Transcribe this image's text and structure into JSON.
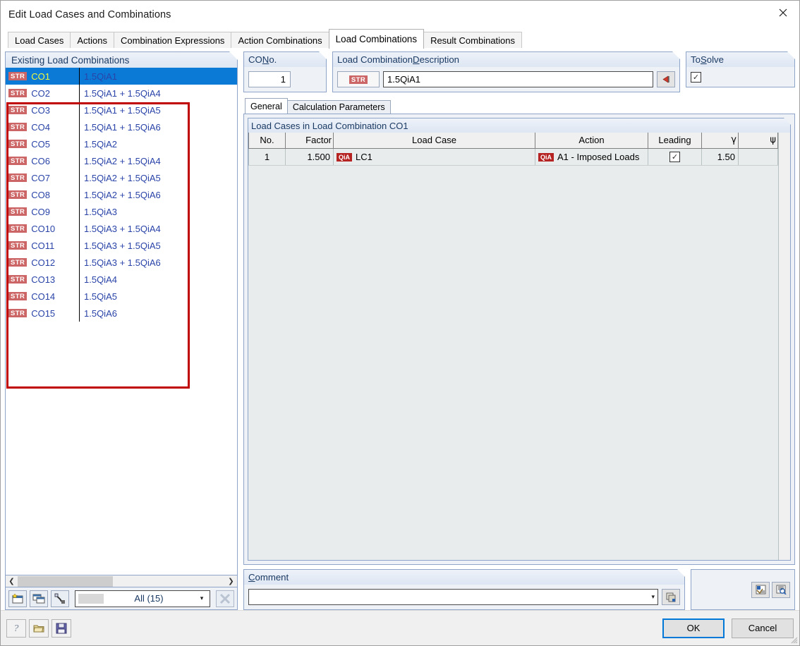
{
  "window": {
    "title": "Edit Load Cases and Combinations",
    "close_icon": "close-icon"
  },
  "tabs": [
    {
      "label": "Load Cases",
      "active": false
    },
    {
      "label": "Actions",
      "active": false
    },
    {
      "label": "Combination Expressions",
      "active": false
    },
    {
      "label": "Action Combinations",
      "active": false
    },
    {
      "label": "Load Combinations",
      "active": true
    },
    {
      "label": "Result Combinations",
      "active": false
    }
  ],
  "left_panel": {
    "header": "Existing Load Combinations",
    "badge_label": "STR",
    "rows": [
      {
        "no": "CO1",
        "desc": "1.5QiA1",
        "selected": true
      },
      {
        "no": "CO2",
        "desc": "1.5QiA1 + 1.5QiA4",
        "selected": false
      },
      {
        "no": "CO3",
        "desc": "1.5QiA1 + 1.5QiA5",
        "selected": false
      },
      {
        "no": "CO4",
        "desc": "1.5QiA1 + 1.5QiA6",
        "selected": false
      },
      {
        "no": "CO5",
        "desc": "1.5QiA2",
        "selected": false
      },
      {
        "no": "CO6",
        "desc": "1.5QiA2 + 1.5QiA4",
        "selected": false
      },
      {
        "no": "CO7",
        "desc": "1.5QiA2 + 1.5QiA5",
        "selected": false
      },
      {
        "no": "CO8",
        "desc": "1.5QiA2 + 1.5QiA6",
        "selected": false
      },
      {
        "no": "CO9",
        "desc": "1.5QiA3",
        "selected": false
      },
      {
        "no": "CO10",
        "desc": "1.5QiA3 + 1.5QiA4",
        "selected": false
      },
      {
        "no": "CO11",
        "desc": "1.5QiA3 + 1.5QiA5",
        "selected": false
      },
      {
        "no": "CO12",
        "desc": "1.5QiA3 + 1.5QiA6",
        "selected": false
      },
      {
        "no": "CO13",
        "desc": "1.5QiA4",
        "selected": false
      },
      {
        "no": "CO14",
        "desc": "1.5QiA5",
        "selected": false
      },
      {
        "no": "CO15",
        "desc": "1.5QiA6",
        "selected": false
      }
    ],
    "scroll_left_icon": "chevron-left-icon",
    "scroll_right_icon": "chevron-right-icon",
    "toolbar": {
      "new_icon": "new-combination-icon",
      "copy_icon": "copy-combination-icon",
      "renumber_icon": "renumber-icon",
      "filter_value": "All (15)",
      "dropdown_icon": "chevron-down-icon",
      "delete_icon": "delete-all-icon"
    }
  },
  "co_no": {
    "label_prefix": "CO ",
    "label_accel": "N",
    "label_suffix": "o.",
    "value": "1"
  },
  "description": {
    "label_prefix": "Load Combination ",
    "label_accel": "D",
    "label_suffix": "escription",
    "badge": "STR",
    "value": "1.5QiA1",
    "button_icon": "back-arrow-icon"
  },
  "to_solve": {
    "label_prefix": "To ",
    "label_accel": "S",
    "label_suffix": "olve",
    "checked": true,
    "check_glyph": "✓"
  },
  "inner_tabs": [
    {
      "label": "General",
      "active": true
    },
    {
      "label": "Calculation Parameters",
      "active": false
    }
  ],
  "table": {
    "caption": "Load Cases in Load Combination CO1",
    "columns": [
      "No.",
      "Factor",
      "Load Case",
      "Action",
      "Leading",
      "γ",
      "ψ"
    ],
    "rows": [
      {
        "no": "1",
        "factor": "1.500",
        "lc_badge": "QiA",
        "load_case": "LC1",
        "action_badge": "QiA",
        "action": "A1 - Imposed Loads",
        "leading": true,
        "leading_glyph": "✓",
        "gamma": "1.50",
        "psi": ""
      }
    ]
  },
  "comment": {
    "label_accel": "C",
    "label_suffix": "omment",
    "value": "",
    "dropdown_icon": "chevron-down-icon",
    "button_icon": "comment-library-icon"
  },
  "right_mini_buttons": {
    "preview_icon": "preview-icon",
    "details_icon": "details-zoom-icon"
  },
  "footer": {
    "help_icon": "help-icon",
    "open_icon": "open-folder-icon",
    "save_icon": "save-icon",
    "ok_label": "OK",
    "cancel_label": "Cancel"
  },
  "colors": {
    "accent_selection": "#0a7ad6",
    "selection_text": "#f2f83c",
    "badge_str": "#cc6666",
    "badge_qia": "#b52323",
    "annotation": "#c00000",
    "group_header_text": "#1b3a63"
  }
}
